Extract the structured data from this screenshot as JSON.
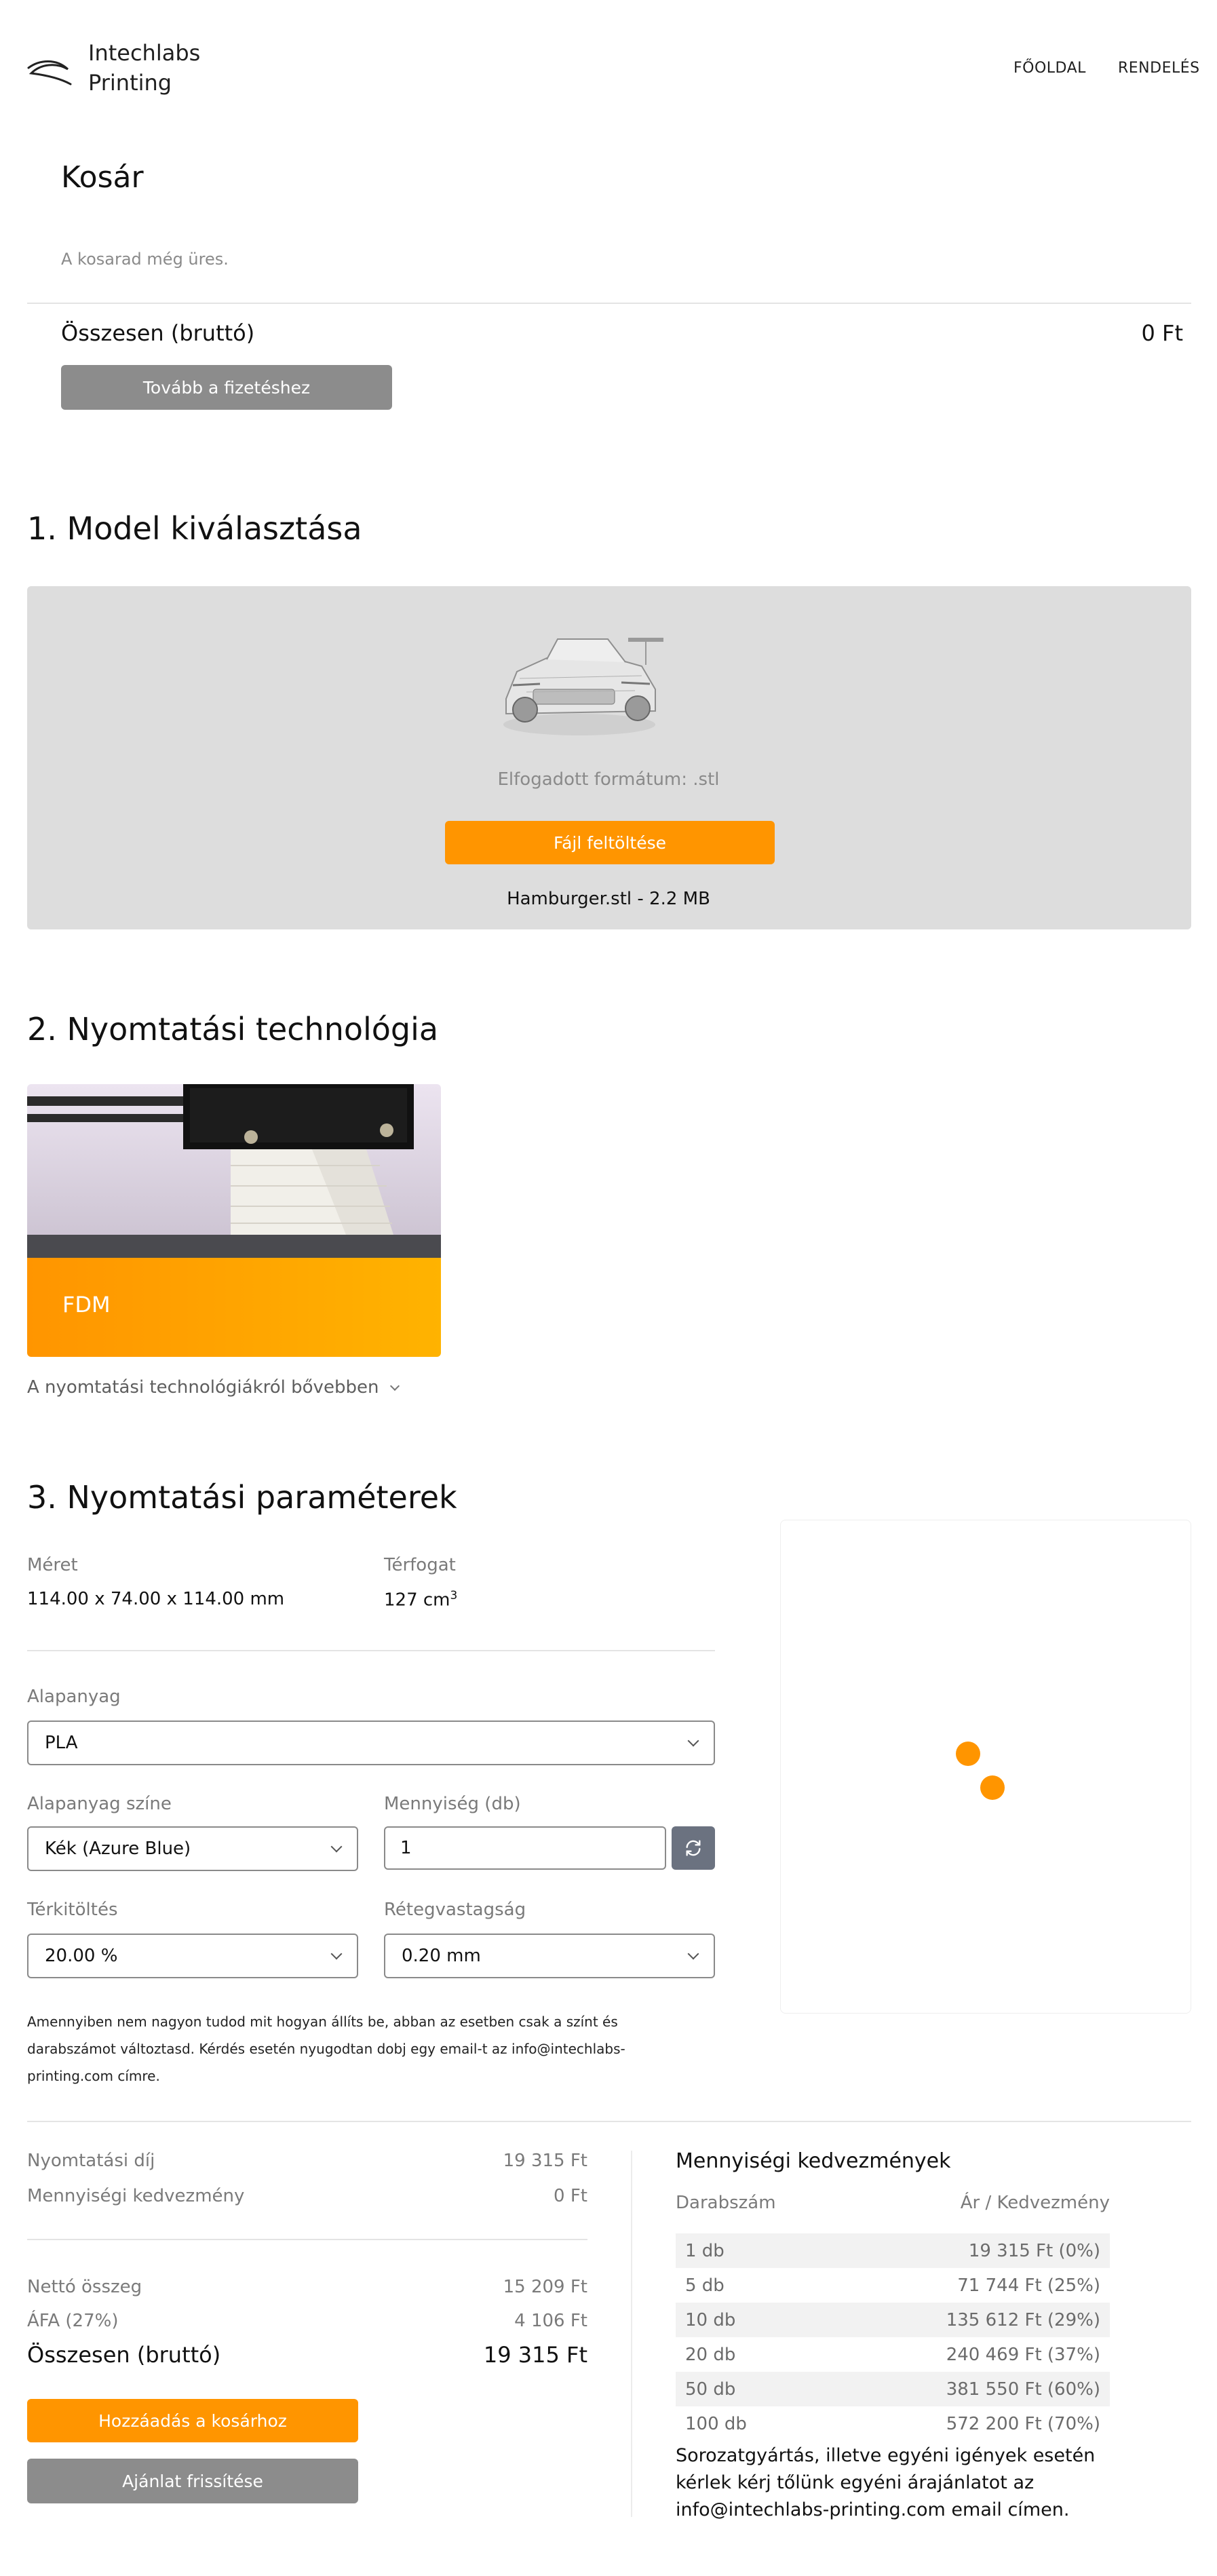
{
  "header": {
    "logo_line1": "Intechlabs",
    "logo_line2": "Printing",
    "nav": [
      "FŐOLDAL",
      "RENDELÉS"
    ]
  },
  "cart": {
    "title": "Kosár",
    "empty_text": "A kosarad még üres.",
    "total_label": "Összesen (bruttó)",
    "total_value": "0 Ft",
    "checkout_button": "Tovább a fizetéshez"
  },
  "step1": {
    "title": "1. Model kiválasztása",
    "formats": "Elfogadott formátum: .stl",
    "upload_button": "Fájl feltöltése",
    "file": "Hamburger.stl - 2.2 MB"
  },
  "step2": {
    "title": "2. Nyomtatási technológia",
    "tech_label": "FDM",
    "more_link": "A nyomtatási technológiákról bővebben"
  },
  "step3": {
    "title": "3. Nyomtatási paraméterek",
    "size_label": "Méret",
    "size_value": "114.00 x 74.00 x 114.00 mm",
    "volume_label": "Térfogat",
    "volume_value": "127 cm",
    "volume_unit_sup": "3",
    "material_label": "Alapanyag",
    "material_value": "PLA",
    "color_label": "Alapanyag színe",
    "color_value": "Kék (Azure Blue)",
    "quantity_label": "Mennyiség (db)",
    "quantity_value": "1",
    "infill_label": "Térkitöltés",
    "infill_value": "20.00 %",
    "layer_label": "Rétegvastagság",
    "layer_value": "0.20 mm",
    "note": "Amennyiben nem nagyon tudod mit hogyan állíts be, abban az esetben csak a színt és darabszámot változtasd. Kérdés esetén nyugodtan dobj egy email-t az info@intechlabs-printing.com címre."
  },
  "summary": {
    "print_fee_label": "Nyomtatási díj",
    "print_fee_value": "19 315 Ft",
    "qty_discount_label": "Mennyiségi kedvezmény",
    "qty_discount_value": "0 Ft",
    "net_label": "Nettó összeg",
    "net_value": "15 209 Ft",
    "vat_label": "ÁFA (27%)",
    "vat_value": "4 106 Ft",
    "gross_label": "Összesen (bruttó)",
    "gross_value": "19 315 Ft",
    "add_to_cart": "Hozzáadás a kosárhoz",
    "refresh_offer": "Ajánlat frissítése"
  },
  "discounts": {
    "title": "Mennyiségi kedvezmények",
    "col_qty": "Darabszám",
    "col_price": "Ár / Kedvezmény",
    "rows": [
      {
        "qty": "1 db",
        "price": "19 315 Ft (0%)"
      },
      {
        "qty": "5 db",
        "price": "71 744 Ft (25%)"
      },
      {
        "qty": "10 db",
        "price": "135 612 Ft (29%)"
      },
      {
        "qty": "20 db",
        "price": "240 469 Ft (37%)"
      },
      {
        "qty": "50 db",
        "price": "381 550 Ft (60%)"
      },
      {
        "qty": "100 db",
        "price": "572 200 Ft (70%)"
      }
    ],
    "note": "Sorozatgyártás, illetve egyéni igények esetén kérlek kérj tőlünk egyéni árajánlatot az info@intechlabs-printing.com email címen."
  },
  "colors": {
    "accent": "#ff9500",
    "button_gray": "#8c8c8c",
    "upload_bg": "#dddddd"
  }
}
